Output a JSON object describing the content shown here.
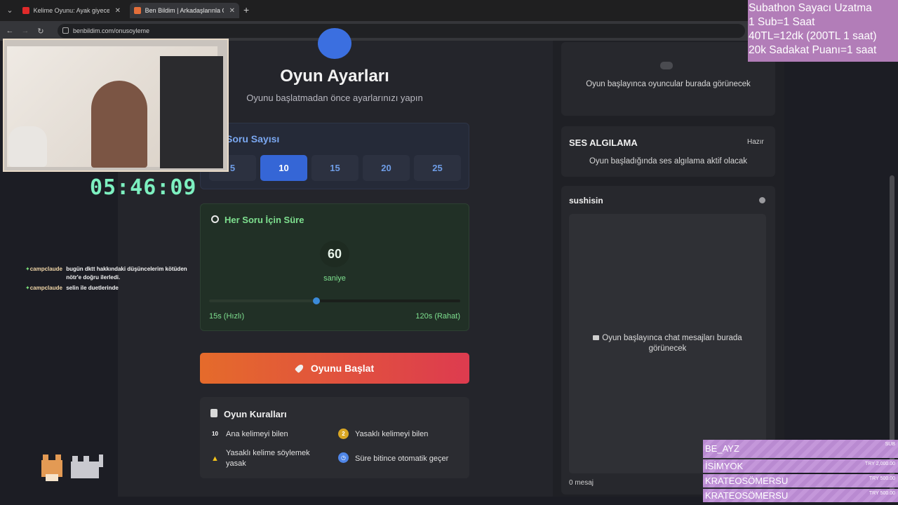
{
  "browser": {
    "tabs": [
      {
        "title": "Kelime Oyunu: Ayak giyecekleri",
        "active": false
      },
      {
        "title": "Ben Bildim | Arkadaşlarınla Onl",
        "active": true
      }
    ],
    "url": "benbildim.com/onusoyleme"
  },
  "header": {
    "title": "Oyun Ayarları",
    "subtitle": "Oyunu başlatmadan önce ayarlarınızı yapın"
  },
  "question_count": {
    "title": "Soru Sayısı",
    "options": [
      "5",
      "10",
      "15",
      "20",
      "25"
    ],
    "selected": "10"
  },
  "time_per_question": {
    "title": "Her Soru İçin Süre",
    "value": "60",
    "unit": "saniye",
    "min_label": "15s (Hızlı)",
    "max_label": "120s (Rahat)",
    "min": 15,
    "max": 120,
    "current": 60
  },
  "start_button": {
    "label": "Oyunu Başlat"
  },
  "rules": {
    "title": "Oyun Kuralları",
    "items": [
      {
        "icon": "10",
        "text": "Ana kelimeyi bilen"
      },
      {
        "icon": "2",
        "text": "Yasaklı kelimeyi bilen"
      },
      {
        "icon": "warning-icon",
        "text": "Yasaklı kelime söylemek yasak"
      },
      {
        "icon": "timer-icon",
        "text": "Süre bitince otomatik geçer"
      }
    ]
  },
  "players_panel": {
    "empty_text": "Oyun başlayınca oyuncular burada görünecek"
  },
  "voice_panel": {
    "title": "SES ALGILAMA",
    "status": "Hazır",
    "text": "Oyun başladığında ses algılama aktif olacak"
  },
  "chat_panel": {
    "username": "sushisin",
    "empty_text": "Oyun başlayınca chat mesajları burada görünecek",
    "count": "0 mesaj"
  },
  "stream_overlay": {
    "timer": "05:46:09",
    "chat": [
      {
        "user": "campclaude",
        "msg": "bugün dktt hakkındaki düşüncelerim kötüden nötr'e doğru ilerledi."
      },
      {
        "user": "campclaude",
        "msg": "selin ile duetlerinde"
      }
    ],
    "subathon": [
      "Subathon Sayacı Uzatma",
      "1 Sub=1 Saat",
      "40TL=12dk (200TL 1 saat)",
      "20k Sadakat Puanı=1 saat"
    ],
    "donations": [
      {
        "name": "BE_AYZ",
        "amount": "SUB"
      },
      {
        "name": "İSİMYOK",
        "amount": "TRY 2,000.00"
      },
      {
        "name": "KRATEOSÖMERSU",
        "amount": "TRY 500.00"
      },
      {
        "name": "KRATEOSÖMERSU",
        "amount": "TRY 500.00"
      }
    ]
  },
  "colors": {
    "accent_blue": "#3566d6",
    "timer_green": "#7df0c0",
    "start_gradient_start": "#e56b2b",
    "start_gradient_end": "#dd3b4f",
    "overlay_purple": "#b27db8"
  }
}
